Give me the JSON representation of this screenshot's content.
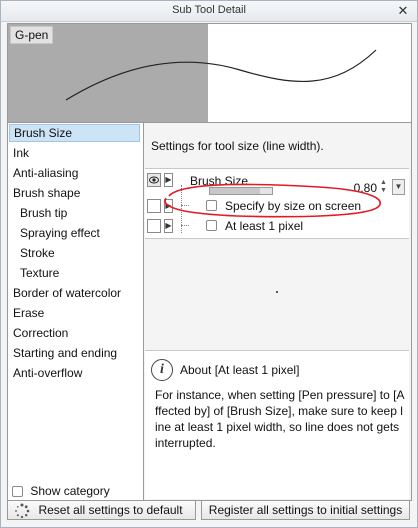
{
  "window": {
    "title": "Sub Tool Detail",
    "close_glyph": "✕"
  },
  "preview": {
    "tool_name": "G-pen"
  },
  "category": {
    "items": [
      {
        "label": "Brush Size",
        "sub": false,
        "selected": true
      },
      {
        "label": "Ink",
        "sub": false
      },
      {
        "label": "Anti-aliasing",
        "sub": false
      },
      {
        "label": "Brush shape",
        "sub": false
      },
      {
        "label": "Brush tip",
        "sub": true
      },
      {
        "label": "Spraying effect",
        "sub": true
      },
      {
        "label": "Stroke",
        "sub": true
      },
      {
        "label": "Texture",
        "sub": true
      },
      {
        "label": "Border of watercolor",
        "sub": false
      },
      {
        "label": "Erase",
        "sub": false
      },
      {
        "label": "Correction",
        "sub": false
      },
      {
        "label": "Starting and ending",
        "sub": false
      },
      {
        "label": "Anti-overflow",
        "sub": false
      }
    ],
    "show_category_label": "Show category"
  },
  "settings": {
    "description": "Settings for tool size (line width).",
    "brush_size": {
      "label": "Brush Size",
      "value": "0.80",
      "slider_level": 0.8
    },
    "specify_by_size_label": "Specify by size on screen",
    "at_least_label": "At least 1 pixel"
  },
  "help": {
    "title": "About [At least 1 pixel]",
    "body": "For instance, when setting [Pen pressure] to [Affected by] of [Brush Size], make sure to keep line at least 1 pixel width, so line does not gets interrupted."
  },
  "footer": {
    "reset_label": "Reset all settings to default",
    "register_label": "Register all settings to initial settings"
  },
  "icons": {
    "close": "close-icon",
    "eye": "eye-icon",
    "help": "info-icon",
    "reset": "reset-spinner-icon"
  },
  "colors": {
    "selection": "#cde4f7",
    "annotation": "#e01b24"
  }
}
